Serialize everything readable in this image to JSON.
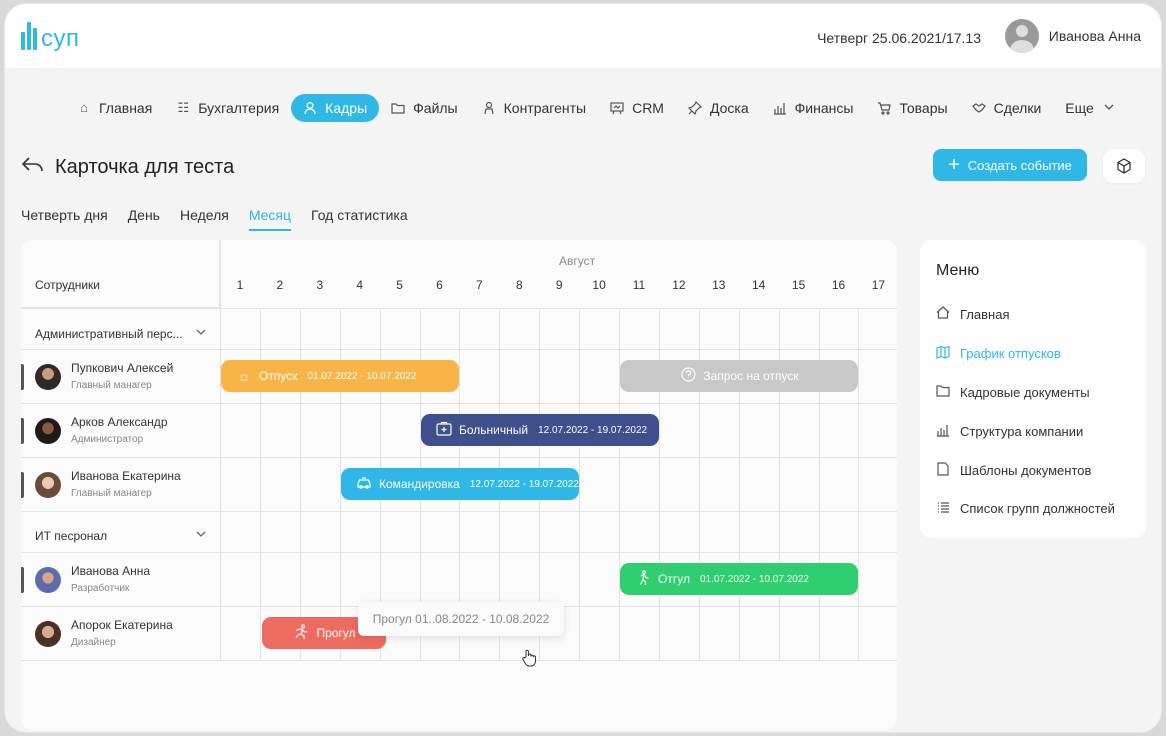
{
  "header": {
    "logo_text": "суп",
    "datetime": "Четверг 25.06.2021/17.13",
    "user_name": "Иванова Анна"
  },
  "nav": {
    "items": [
      {
        "label": "Главная",
        "icon": "home-icon"
      },
      {
        "label": "Бухгалтерия",
        "icon": "ledger-icon"
      },
      {
        "label": "Кадры",
        "icon": "person-icon",
        "active": true
      },
      {
        "label": "Файлы",
        "icon": "folder-icon"
      },
      {
        "label": "Контрагенты",
        "icon": "contractor-icon"
      },
      {
        "label": "CRM",
        "icon": "crm-icon"
      },
      {
        "label": "Доска",
        "icon": "pin-icon"
      },
      {
        "label": "Финансы",
        "icon": "bar-chart-icon"
      },
      {
        "label": "Товары",
        "icon": "cart-icon"
      },
      {
        "label": "Сделки",
        "icon": "handshake-icon"
      },
      {
        "label": "Еще",
        "icon": "chevron-down-icon"
      }
    ]
  },
  "page": {
    "title": "Карточка для теста",
    "create_button": "Создать событие"
  },
  "view_tabs": [
    "Четверть дня",
    "День",
    "Неделя",
    "Месяц",
    "Год статистика"
  ],
  "active_view": "Месяц",
  "schedule": {
    "column_label": "Сотрудники",
    "month": "Август",
    "days": [
      "1",
      "2",
      "3",
      "4",
      "5",
      "6",
      "7",
      "8",
      "9",
      "10",
      "11",
      "12",
      "13",
      "14",
      "15",
      "16",
      "17"
    ],
    "groups": [
      {
        "label": "Административный перс..."
      },
      {
        "label": "ИТ песронал"
      }
    ],
    "employees": [
      {
        "name": "Пупкович Алексей",
        "role": "Главный манагер"
      },
      {
        "name": "Арков Александр",
        "role": "Администратор"
      },
      {
        "name": "Иванова Екатерина",
        "role": "Главный манагер"
      },
      {
        "name": "Иванова Анна",
        "role": "Разработчик"
      },
      {
        "name": "Апорок Екатерина",
        "role": "Дизайнер"
      }
    ],
    "events": [
      {
        "label": "Отпуск",
        "dates": "01.07.2022 - 10.07.2022",
        "color": "#f7b548",
        "icon": "sun-icon"
      },
      {
        "label": "Запрос на отпуск",
        "dates": "",
        "color": "#c8c8c8",
        "icon": "question-icon"
      },
      {
        "label": "Больничный",
        "dates": "12.07.2022 - 19.07.2022",
        "color": "#3f4f8c",
        "icon": "medkit-icon"
      },
      {
        "label": "Командировка",
        "dates": "12.07.2022 - 19.07.2022",
        "color": "#2fb7e6",
        "icon": "car-icon"
      },
      {
        "label": "Отгул",
        "dates": "01.07.2022 - 10.07.2022",
        "color": "#2fce6f",
        "icon": "walk-icon"
      },
      {
        "label": "Прогул",
        "dates": "",
        "color": "#ef6a5f",
        "icon": "run-icon"
      }
    ],
    "tooltip": "Прогул 01..08.2022 - 10.08.2022"
  },
  "side_menu": {
    "title": "Меню",
    "items": [
      {
        "label": "Главная",
        "icon": "home-icon"
      },
      {
        "label": "График отпусков",
        "icon": "map-icon",
        "active": true
      },
      {
        "label": "Кадровые документы",
        "icon": "folder-icon"
      },
      {
        "label": "Структура компании",
        "icon": "bar-chart-icon"
      },
      {
        "label": "Шаблоны документов",
        "icon": "document-icon"
      },
      {
        "label": "Список групп должностей",
        "icon": "list-icon"
      }
    ]
  },
  "colors": {
    "accent": "#2fb7e6"
  }
}
